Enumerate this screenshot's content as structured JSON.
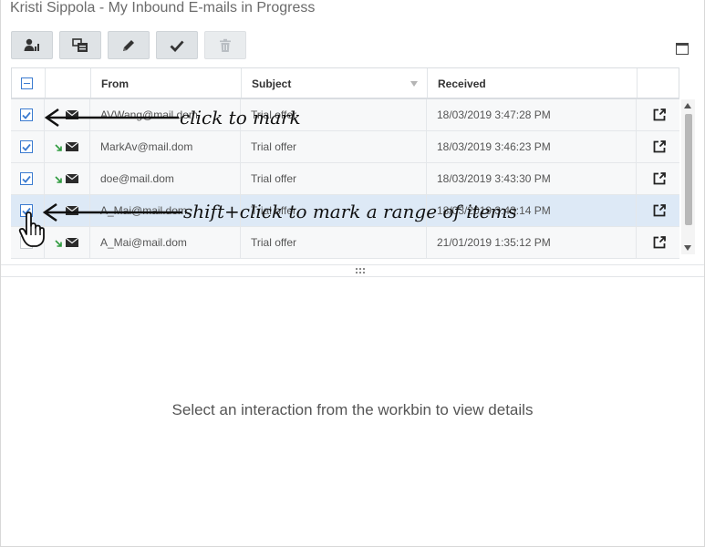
{
  "window": {
    "title": "Kristi Sippola - My Inbound E-mails in Progress"
  },
  "toolbar": {
    "buttons": [
      {
        "icon": "workbin-person-icon"
      },
      {
        "icon": "move-to-workbin-icon"
      },
      {
        "icon": "edit-pencil-icon"
      },
      {
        "icon": "mark-done-check-icon"
      },
      {
        "icon": "delete-trash-icon",
        "disabled": true
      }
    ]
  },
  "grid": {
    "columns": {
      "from": "From",
      "subject": "Subject",
      "received": "Received"
    },
    "rows": [
      {
        "checked": true,
        "from": "AVWang@mail.dom",
        "subject": "Trial offer",
        "received": "18/03/2019 3:47:28 PM",
        "inbound_arrow": false
      },
      {
        "checked": true,
        "from": "MarkAv@mail.dom",
        "subject": "Trial offer",
        "received": "18/03/2019 3:46:23 PM",
        "inbound_arrow": true
      },
      {
        "checked": true,
        "from": "doe@mail.dom",
        "subject": "Trial offer",
        "received": "18/03/2019 3:43:30 PM",
        "inbound_arrow": true
      },
      {
        "checked": true,
        "selected": true,
        "from": "A_Mai@mail.dom",
        "subject": "Trial offer",
        "received": "18/03/2019 3:43:14 PM",
        "inbound_arrow": false
      },
      {
        "checked": false,
        "from": "A_Mai@mail.dom",
        "subject": "Trial offer",
        "received": "21/01/2019 1:35:12 PM",
        "inbound_arrow": true
      }
    ]
  },
  "details": {
    "empty_message": "Select an interaction from the workbin to view details"
  },
  "annotations": {
    "click_to_mark": "click to mark",
    "shift_click": "shift+click to mark a range of items"
  },
  "colors": {
    "accent": "#3b7bd0",
    "inbound_arrow": "#2e9a3e",
    "selected_row": "#dde9f6"
  }
}
